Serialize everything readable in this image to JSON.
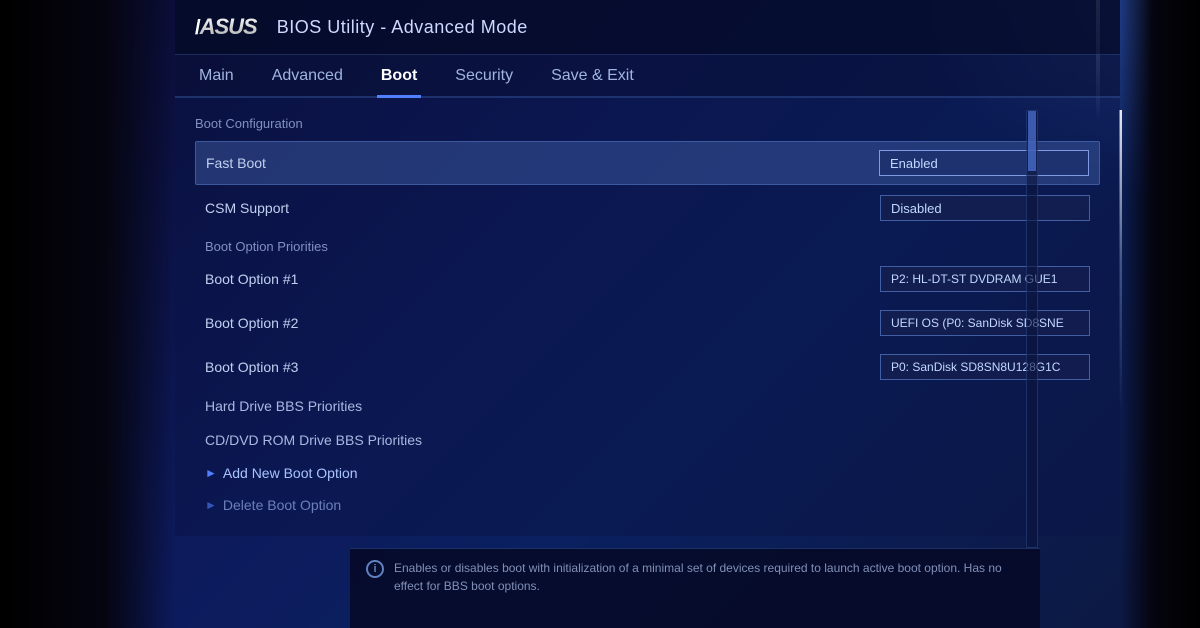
{
  "bios": {
    "title": "BIOS Utility - Advanced Mode",
    "logo": "/ASUS"
  },
  "nav": {
    "tabs": [
      {
        "id": "main",
        "label": "Main",
        "active": false
      },
      {
        "id": "advanced",
        "label": "Advanced",
        "active": false
      },
      {
        "id": "boot",
        "label": "Boot",
        "active": true
      },
      {
        "id": "security",
        "label": "Security",
        "active": false
      },
      {
        "id": "save-exit",
        "label": "Save & Exit",
        "active": false
      }
    ]
  },
  "main": {
    "section_title": "Boot Configuration",
    "rows": [
      {
        "id": "fast-boot",
        "label": "Fast Boot",
        "value": "Enabled",
        "highlighted": true
      },
      {
        "id": "csm-support",
        "label": "CSM Support",
        "value": "Disabled",
        "highlighted": false
      }
    ],
    "sub_section_title": "Boot Option Priorities",
    "boot_options": [
      {
        "id": "boot-opt-1",
        "label": "Boot Option #1",
        "value": "P2: HL-DT-ST DVDRAM GUE1"
      },
      {
        "id": "boot-opt-2",
        "label": "Boot Option #2",
        "value": "UEFI OS (P0: SanDisk SD8SNE"
      },
      {
        "id": "boot-opt-3",
        "label": "Boot Option #3",
        "value": "P0: SanDisk SD8SN8U128G1C"
      }
    ],
    "link_rows": [
      {
        "id": "hdd-bbs",
        "label": "Hard Drive BBS Priorities"
      },
      {
        "id": "cddvd-bbs",
        "label": "CD/DVD ROM Drive BBS Priorities"
      }
    ],
    "arrow_rows": [
      {
        "id": "add-boot",
        "label": "Add New Boot Option"
      },
      {
        "id": "delete-boot",
        "label": "Delete Boot Option"
      }
    ],
    "info_text": "Enables or disables boot with initialization of a minimal set of devices required to launch active boot option. Has no effect for BBS boot options."
  }
}
